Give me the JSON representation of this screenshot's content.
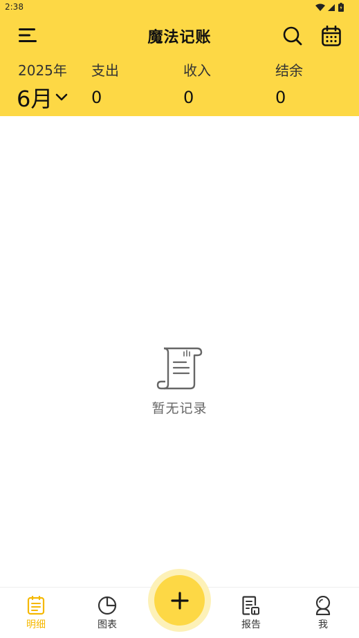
{
  "status_bar": {
    "time": "2:38"
  },
  "header": {
    "title": "魔法记账",
    "year": "2025年",
    "month": "6月",
    "expense": {
      "label": "支出",
      "value": "0"
    },
    "income": {
      "label": "收入",
      "value": "0"
    },
    "balance": {
      "label": "结余",
      "value": "0"
    }
  },
  "icons": {
    "menu": "menu-icon",
    "search": "search-icon",
    "calendar": "calendar-icon",
    "empty": "scroll-document-icon",
    "add": "plus-icon"
  },
  "empty_state": {
    "text": "暂无记录"
  },
  "bottom_nav": {
    "items": [
      {
        "label": "明细",
        "active": true
      },
      {
        "label": "图表",
        "active": false
      },
      {
        "label": "报告",
        "active": false
      },
      {
        "label": "我",
        "active": false
      }
    ]
  },
  "colors": {
    "accent": "#FDD845",
    "active": "#F5B800",
    "halo": "#FDF1B8"
  }
}
